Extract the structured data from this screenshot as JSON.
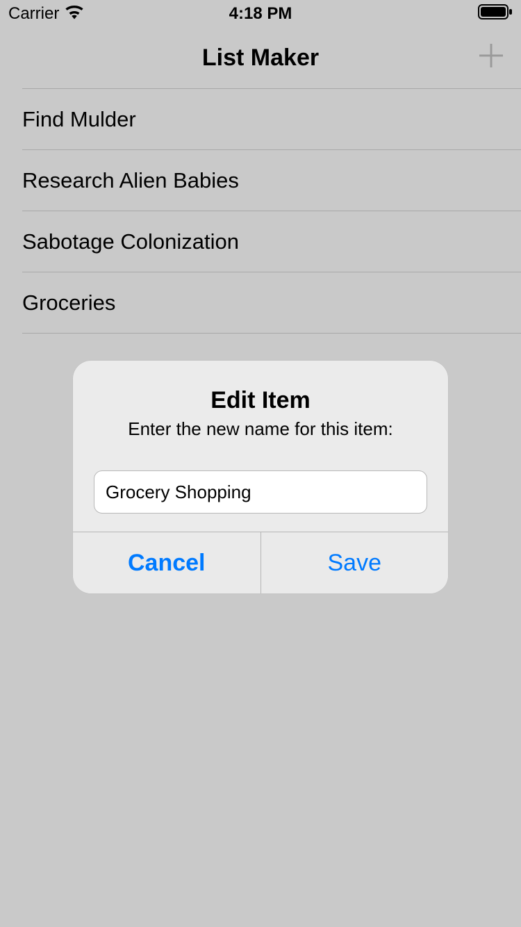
{
  "status_bar": {
    "carrier": "Carrier",
    "time": "4:18 PM"
  },
  "nav": {
    "title": "List Maker"
  },
  "lists": [
    {
      "label": "Find Mulder"
    },
    {
      "label": "Research Alien Babies"
    },
    {
      "label": "Sabotage Colonization"
    },
    {
      "label": "Groceries"
    }
  ],
  "alert": {
    "title": "Edit Item",
    "message": "Enter the new name for this item:",
    "input_value": "Grocery Shopping",
    "cancel_label": "Cancel",
    "save_label": "Save"
  }
}
